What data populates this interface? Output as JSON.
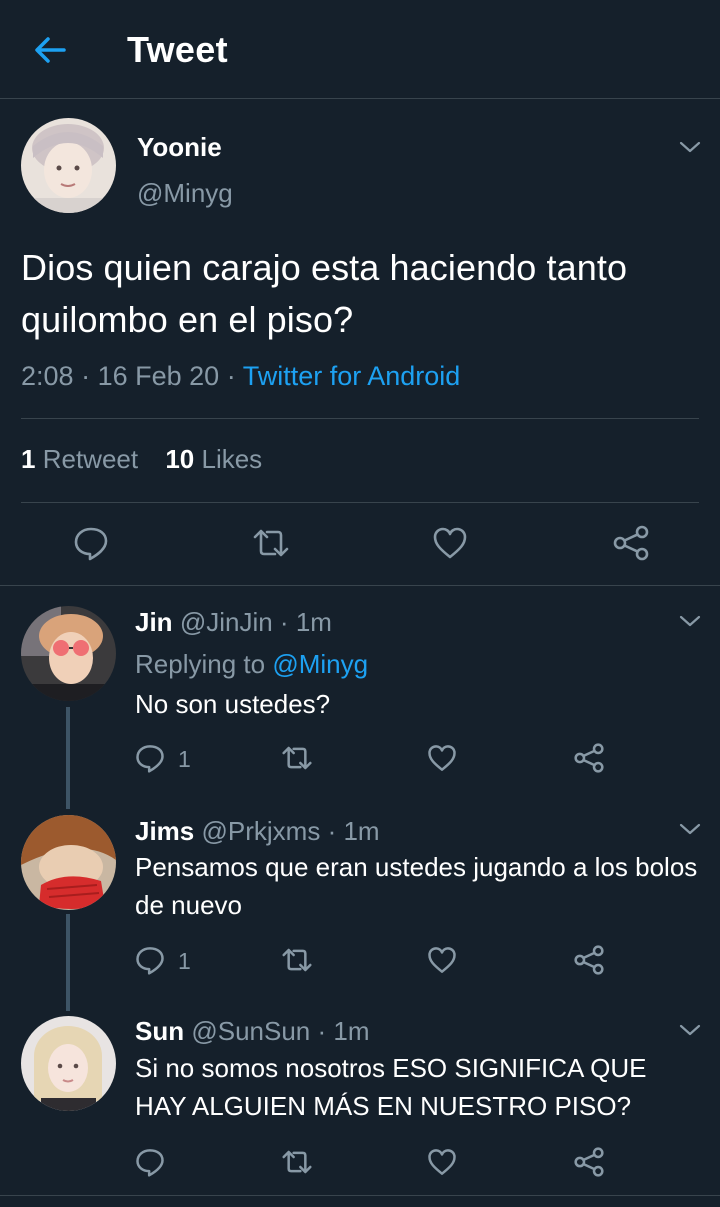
{
  "header": {
    "title": "Tweet"
  },
  "main_tweet": {
    "name": "Yoonie",
    "handle": "@Minyg",
    "text": "Dios quien carajo esta haciendo tanto quilombo en el piso?",
    "time": "2:08",
    "date": "16 Feb 20",
    "source": "Twitter for Android",
    "retweets_count": "1",
    "retweets_label": "Retweet",
    "likes_count": "10",
    "likes_label": "Likes"
  },
  "replies": [
    {
      "name": "Jin",
      "handle": "@JinJin",
      "time": "1m",
      "replying_label": "Replying to",
      "replying_to": "@Minyg",
      "text": "No son ustedes?",
      "reply_count": "1"
    },
    {
      "name": "Jims",
      "handle": "@Prkjxms",
      "time": "1m",
      "text": "Pensamos que eran ustedes jugando a los bolos de nuevo",
      "reply_count": "1"
    },
    {
      "name": "Sun",
      "handle": "@SunSun",
      "time": "1m",
      "text": "Si no somos nosotros ESO SIGNIFICA QUE HAY ALGUIEN MÁS EN NUESTRO PISO?",
      "reply_count": ""
    }
  ],
  "separators": {
    "dot": "·"
  },
  "icons": {
    "back": "arrow-left-icon",
    "reply": "speech-bubble-icon",
    "retweet": "retweet-icon",
    "like": "heart-icon",
    "share": "share-icon",
    "more": "chevron-down-icon"
  },
  "colors": {
    "background": "#15202b",
    "accent": "#1da1f2",
    "secondary_text": "#8899a6",
    "divider": "#38444d"
  }
}
